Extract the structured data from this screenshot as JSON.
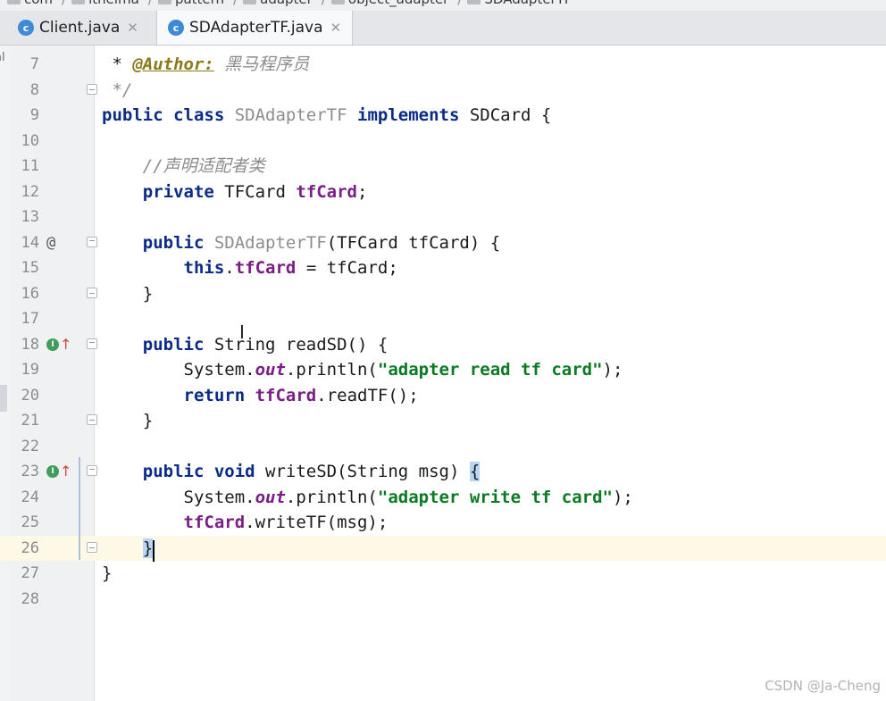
{
  "breadcrumb": {
    "items": [
      "com",
      "itheima",
      "pattern",
      "adapter",
      "object_adapter",
      "SDAdapterTF"
    ]
  },
  "tabs": [
    {
      "label": "Client.java",
      "icon": "java-class-icon",
      "icon_color": "#3b8bd6",
      "active": false
    },
    {
      "label": "SDAdapterTF.java",
      "icon": "java-class-icon",
      "icon_color": "#3b8bd6",
      "active": true
    }
  ],
  "sidebar": {
    "label": "al"
  },
  "colors": {
    "keyword": "#0b2b8a",
    "string": "#0b7a25",
    "field": "#7a1f86",
    "comment": "#8c8c8c",
    "current_line": "#fdf9e6",
    "gutter": "#f0f1f3"
  },
  "editor": {
    "current_line": 26,
    "lines": [
      {
        "num": "7",
        "tokens": [
          [
            "plain",
            " * "
          ],
          [
            "doc-tag",
            "@Author:"
          ],
          [
            "plain",
            " "
          ],
          [
            "doc-text",
            "黑马程序员"
          ]
        ]
      },
      {
        "num": "8",
        "tokens": [
          [
            "comment",
            " */"
          ]
        ],
        "fold": "close"
      },
      {
        "num": "9",
        "tokens": [
          [
            "kw",
            "public class"
          ],
          [
            "plain",
            " "
          ],
          [
            "fname",
            "SDAdapterTF"
          ],
          [
            "plain",
            " "
          ],
          [
            "kw",
            "implements"
          ],
          [
            "plain",
            " SDCard {"
          ]
        ]
      },
      {
        "num": "10",
        "tokens": []
      },
      {
        "num": "11",
        "tokens": [
          [
            "plain",
            "    "
          ],
          [
            "comment",
            "//声明适配者类"
          ]
        ]
      },
      {
        "num": "12",
        "tokens": [
          [
            "plain",
            "    "
          ],
          [
            "kw",
            "private"
          ],
          [
            "plain",
            " TFCard "
          ],
          [
            "field",
            "tfCard"
          ],
          [
            "plain",
            ";"
          ]
        ]
      },
      {
        "num": "13",
        "tokens": []
      },
      {
        "num": "14",
        "tokens": [
          [
            "plain",
            "    "
          ],
          [
            "kw",
            "public"
          ],
          [
            "plain",
            " "
          ],
          [
            "fname",
            "SDAdapterTF"
          ],
          [
            "plain",
            "(TFCard tfCard) {"
          ]
        ],
        "mark": "@",
        "fold": "open"
      },
      {
        "num": "15",
        "tokens": [
          [
            "plain",
            "        "
          ],
          [
            "kw",
            "this"
          ],
          [
            "plain",
            "."
          ],
          [
            "field",
            "tfCard"
          ],
          [
            "plain",
            " = tfCard;"
          ]
        ]
      },
      {
        "num": "16",
        "tokens": [
          [
            "plain",
            "    }"
          ]
        ],
        "fold": "close"
      },
      {
        "num": "17",
        "tokens": []
      },
      {
        "num": "18",
        "tokens": [
          [
            "plain",
            "    "
          ],
          [
            "kw",
            "public"
          ],
          [
            "plain",
            " String readSD() {"
          ]
        ],
        "mark": "impl",
        "fold": "open"
      },
      {
        "num": "19",
        "tokens": [
          [
            "plain",
            "        System."
          ],
          [
            "static",
            "out"
          ],
          [
            "plain",
            ".println("
          ],
          [
            "str",
            "\"adapter read tf card\""
          ],
          [
            "plain",
            ");"
          ]
        ]
      },
      {
        "num": "20",
        "tokens": [
          [
            "plain",
            "        "
          ],
          [
            "kw",
            "return"
          ],
          [
            "plain",
            " "
          ],
          [
            "field",
            "tfCard"
          ],
          [
            "plain",
            ".readTF();"
          ]
        ]
      },
      {
        "num": "21",
        "tokens": [
          [
            "plain",
            "    }"
          ]
        ],
        "fold": "close"
      },
      {
        "num": "22",
        "tokens": []
      },
      {
        "num": "23",
        "tokens": [
          [
            "plain",
            "    "
          ],
          [
            "kw",
            "public void"
          ],
          [
            "plain",
            " writeSD(String msg) "
          ],
          [
            "brace-hl",
            "{"
          ]
        ],
        "mark": "impl",
        "fold": "open"
      },
      {
        "num": "24",
        "tokens": [
          [
            "plain",
            "        System."
          ],
          [
            "static",
            "out"
          ],
          [
            "plain",
            ".println("
          ],
          [
            "str",
            "\"adapter write tf card\""
          ],
          [
            "plain",
            ");"
          ]
        ]
      },
      {
        "num": "25",
        "tokens": [
          [
            "plain",
            "        "
          ],
          [
            "field",
            "tfCard"
          ],
          [
            "plain",
            ".writeTF(msg);"
          ]
        ]
      },
      {
        "num": "26",
        "tokens": [
          [
            "plain",
            "    "
          ],
          [
            "caret-brace",
            "}"
          ]
        ],
        "fold": "close"
      },
      {
        "num": "27",
        "tokens": [
          [
            "plain",
            "}"
          ]
        ]
      },
      {
        "num": "28",
        "tokens": []
      }
    ]
  },
  "watermark": "CSDN @Ja-Cheng"
}
